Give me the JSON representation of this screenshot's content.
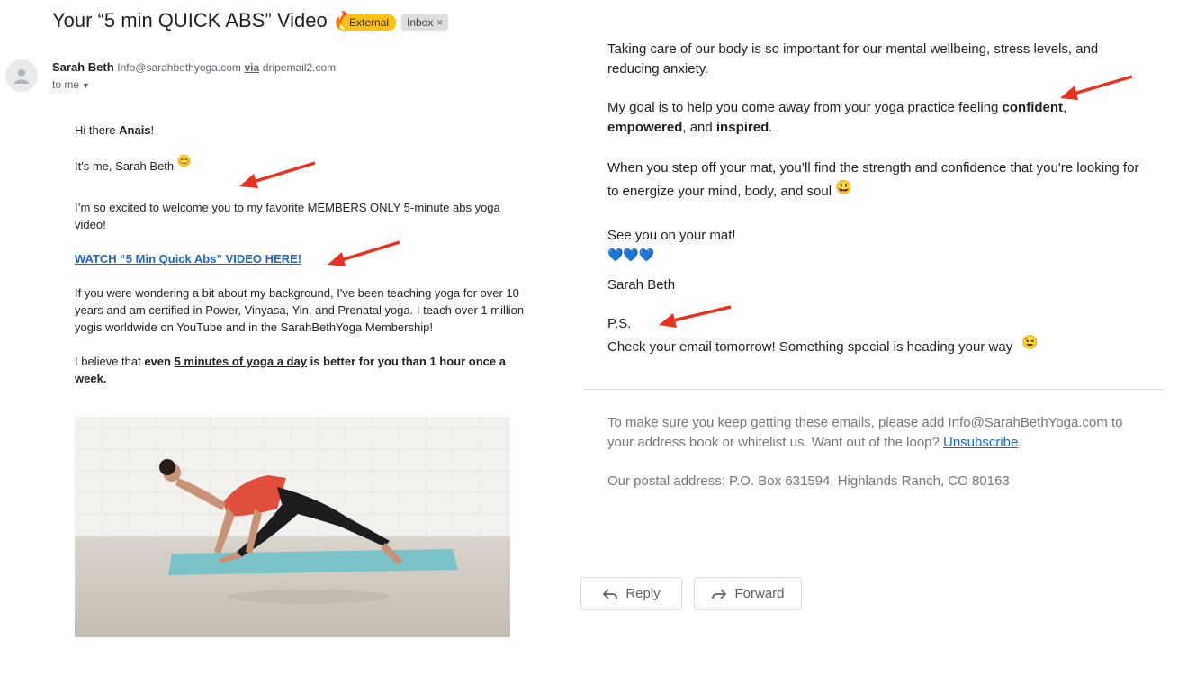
{
  "email": {
    "subject": "Your “5 min QUICK ABS” Video",
    "subject_emoji": "🔥",
    "labels": {
      "external": "External",
      "inbox": "Inbox",
      "inbox_close": "×"
    },
    "sender": {
      "name": "Sarah Beth",
      "address": "Info@sarahbethyoga.com",
      "via_label": "via",
      "via_domain": "dripemail2.com"
    },
    "to_label": "to me"
  },
  "body_left": {
    "greeting_prefix": "Hi there ",
    "greeting_name": "Anais",
    "greeting_suffix": "!",
    "intro": "It's me, Sarah Beth",
    "intro_emoji": "😊",
    "welcome": "I’m so excited to welcome you to my favorite MEMBERS ONLY 5-minute abs yoga video!",
    "cta_link": "WATCH “5 Min Quick Abs” VIDEO HERE!",
    "background": "If you were wondering a bit about my background, I've been teaching yoga for over 10 years and am certified in Power, Vinyasa, Yin, and Prenatal yoga. I teach over 1 million yogis worldwide on YouTube and in the SarahBethYoga Membership!",
    "belief_prefix": "I believe that ",
    "belief_bold1": "even ",
    "belief_underline": "5 minutes of yoga a day",
    "belief_bold2": " is better for you than 1 hour once a week."
  },
  "body_right": {
    "p1": "Taking care of our body is so important for our mental wellbeing, stress levels, and reducing anxiety.",
    "p2_prefix": "My goal is to help you come away from your yoga practice feeling ",
    "p2_b1": "confident",
    "p2_sep1": ", ",
    "p2_b2": "empowered",
    "p2_sep2": ", and ",
    "p2_b3": "inspired",
    "p2_end": ".",
    "p3": "When you step off your mat, you’ll find the strength and confidence that you're looking for to energize your mind, body, and soul",
    "p3_emoji": "😃",
    "signoff": "See you on your mat!",
    "hearts": "💙💙💙",
    "signature": "Sarah Beth",
    "ps_label": "P.S.",
    "ps_text": "Check your email tomorrow! Something special is heading your way",
    "ps_emoji": "😉"
  },
  "footer": {
    "text_prefix": "To make sure you keep getting these emails, please add Info@SarahBethYoga.com to your address book or whitelist us. Want out of the loop? ",
    "unsubscribe": "Unsubscribe",
    "text_suffix": ".",
    "postal": "Our postal address: P.O. Box 631594, Highlands Ranch, CO 80163"
  },
  "actions": {
    "reply": "Reply",
    "forward": "Forward"
  },
  "colors": {
    "annotation_arrow": "#e8311e",
    "link": "#1a67c9",
    "external_badge": "#f9c213"
  }
}
